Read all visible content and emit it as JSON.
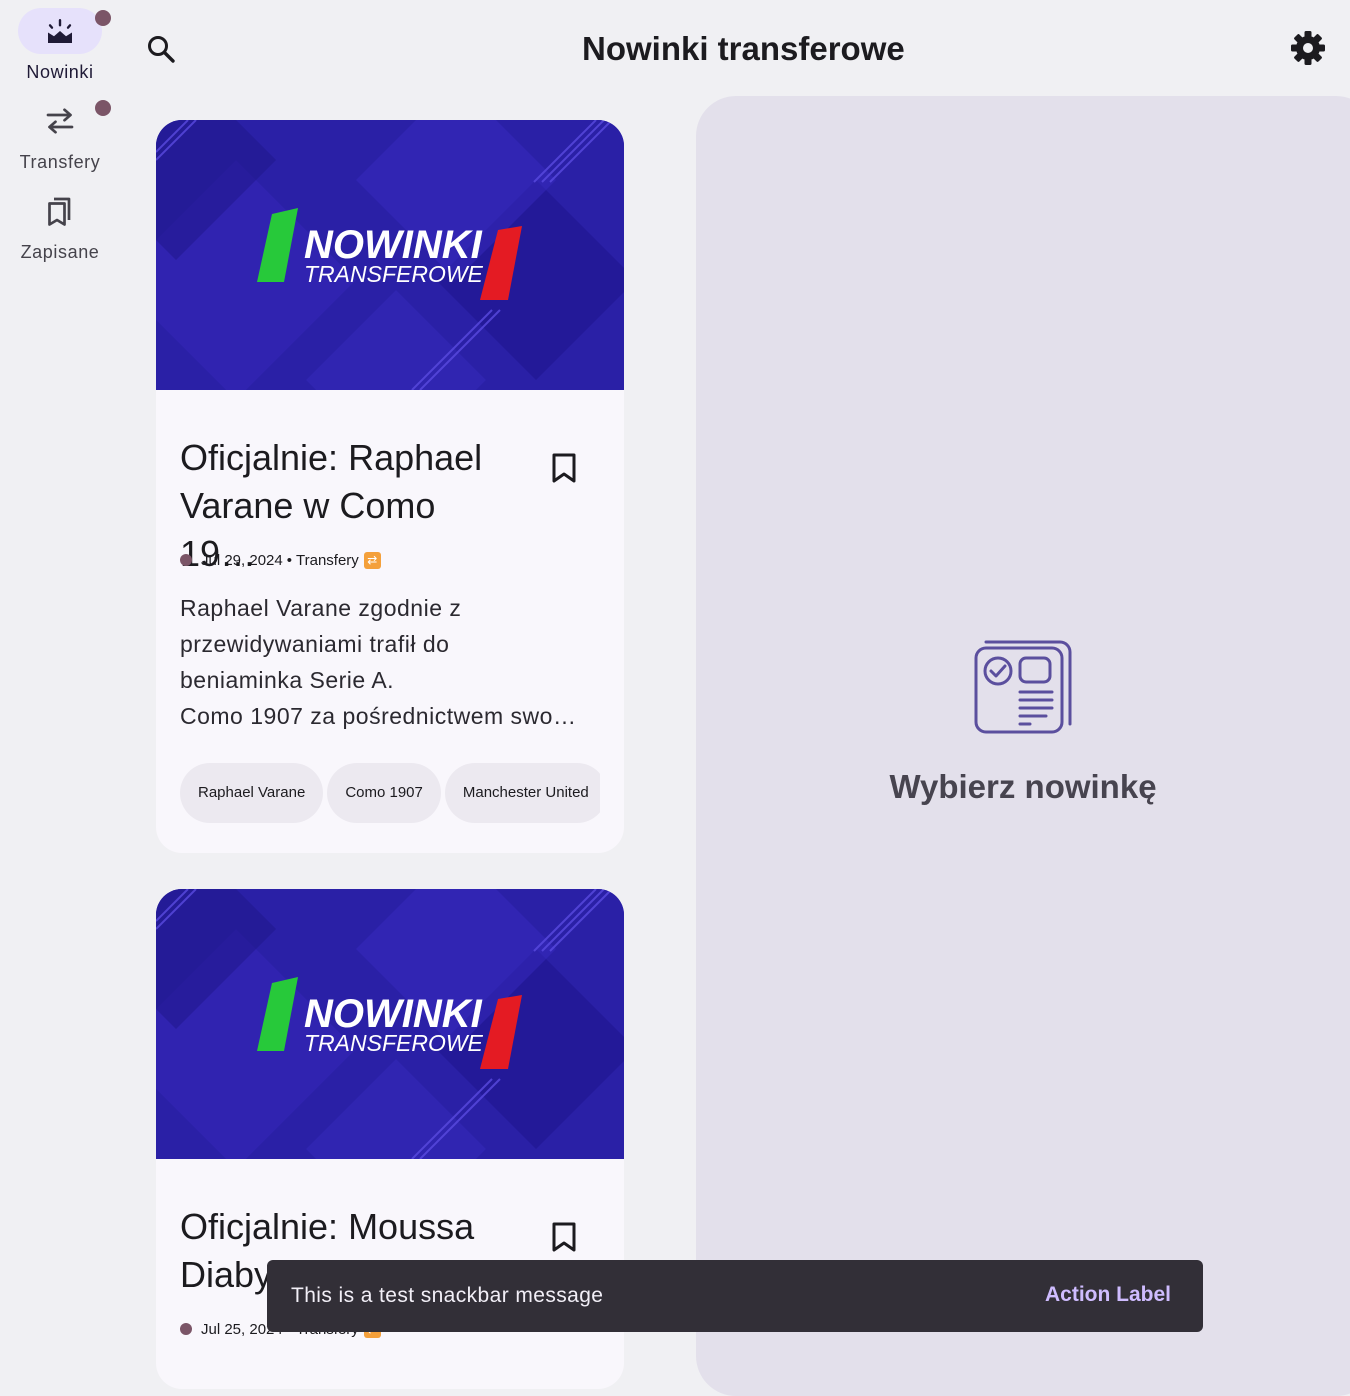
{
  "app": {
    "title": "Nowinki transferowe"
  },
  "rail": {
    "items": [
      {
        "label": "Nowinki",
        "icon": "news-burst-icon",
        "active": true,
        "badge": true
      },
      {
        "label": "Transfery",
        "icon": "swap-arrows-icon",
        "active": false,
        "badge": true
      },
      {
        "label": "Zapisane",
        "icon": "saved-bookmarks-icon",
        "active": false,
        "badge": false
      }
    ]
  },
  "toolbar": {
    "search_icon": "search-icon",
    "settings_icon": "gear-icon"
  },
  "articles": [
    {
      "image_logo_top": "NOWINKI",
      "image_logo_bottom": "TRANSFEROWE",
      "title": "Oficjalnie: Raphael Varane w Como 19…",
      "date": "Jul 29, 2024",
      "separator": "•",
      "category": "Transfery",
      "category_emoji": "🔁",
      "summary_lines": [
        "Raphael Varane zgodnie z",
        "przewidywaniami trafił do",
        "beniaminka Serie A.",
        "Como 1907 za pośrednictwem swo…"
      ],
      "tags": [
        "Raphael Varane",
        "Como 1907",
        "Manchester United"
      ]
    },
    {
      "image_logo_top": "NOWINKI",
      "image_logo_bottom": "TRANSFEROWE",
      "title": "Oficjalnie: Moussa Diaby",
      "date": "Jul 25, 2024",
      "separator": "•",
      "category": "Transfery",
      "category_emoji": "🔁"
    }
  ],
  "detail": {
    "empty_text": "Wybierz nowinkę",
    "empty_icon": "news-article-icon"
  },
  "snackbar": {
    "message": "This is a test snackbar message",
    "action": "Action Label"
  },
  "colors": {
    "background": "#f0f0f3",
    "accent": "#6750a4",
    "badge": "#7b5567",
    "detail_pane": "#e3e0eb",
    "hero_blue": "#2a20a6",
    "snackbar": "#322f37",
    "snackbar_action": "#cfbcff"
  }
}
